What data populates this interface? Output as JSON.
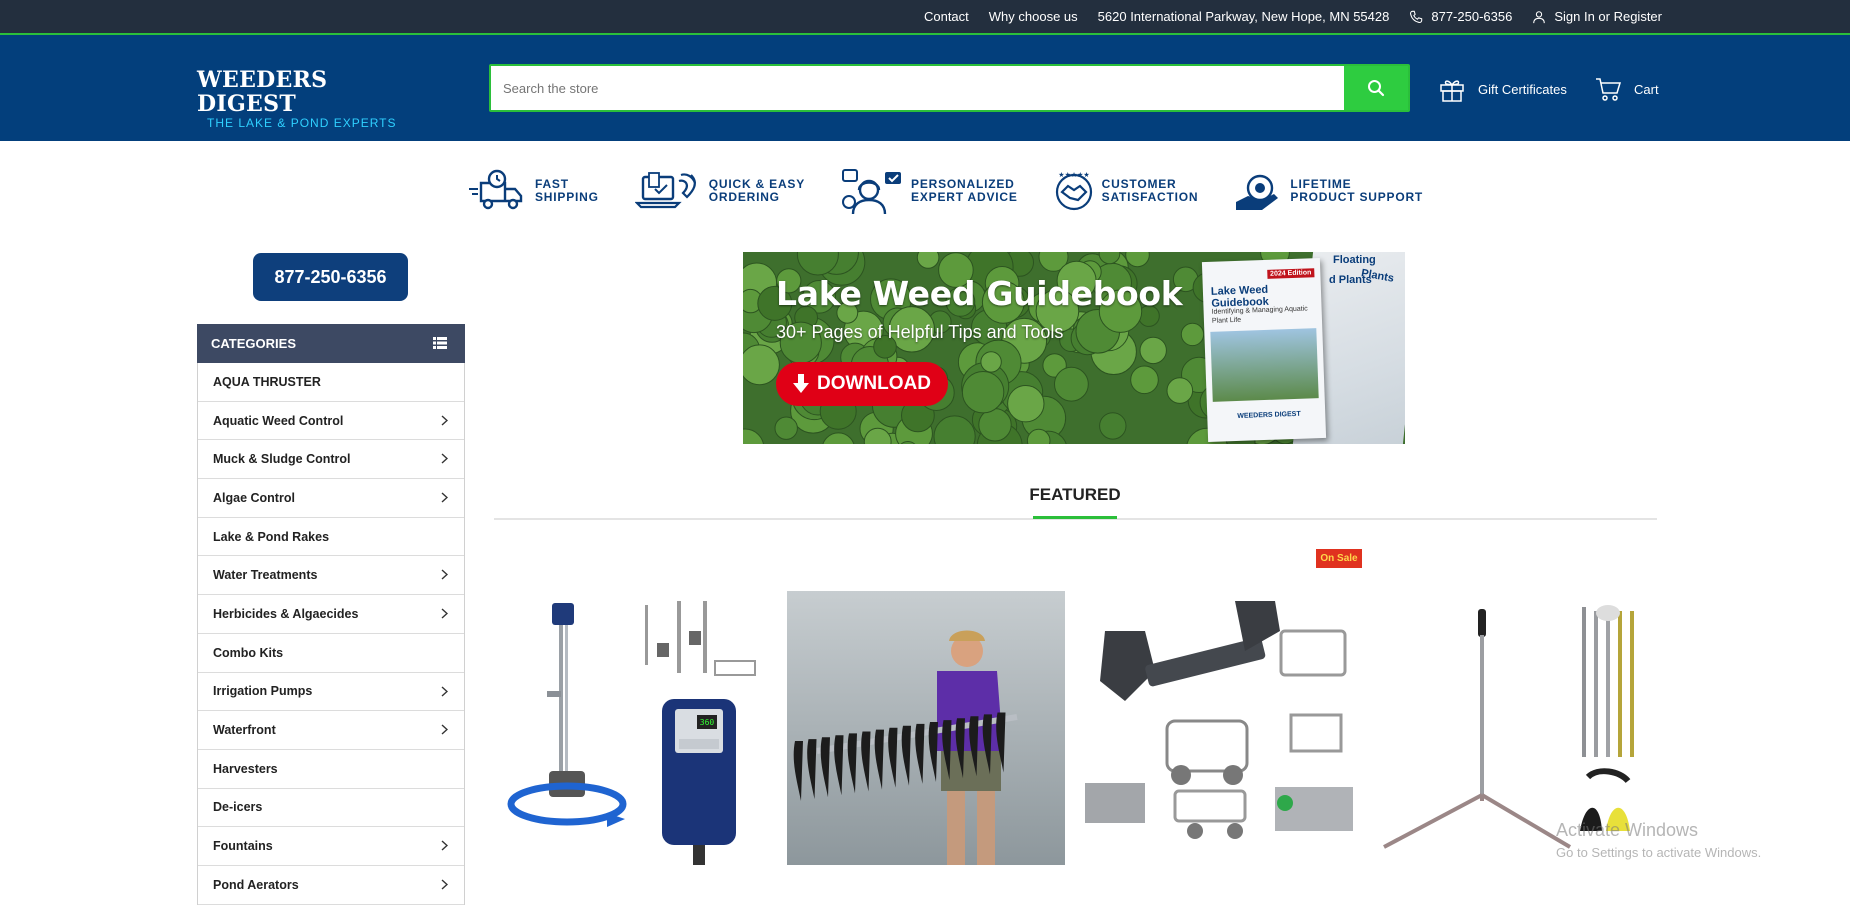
{
  "topbar": {
    "contact": "Contact",
    "why": "Why choose us",
    "address": "5620 International Parkway, New Hope, MN 55428",
    "phone": "877-250-6356",
    "signin": "Sign In or Register"
  },
  "header": {
    "logo_line1": "WEEDERS DIGEST",
    "logo_line2": "THE LAKE & POND EXPERTS",
    "search_placeholder": "Search the store",
    "gift": "Gift Certificates",
    "cart": "Cart"
  },
  "features": [
    {
      "line1": "FAST",
      "line2": "SHIPPING",
      "icon": "truck-icon"
    },
    {
      "line1": "QUICK & EASY",
      "line2": "ORDERING",
      "icon": "order-icon"
    },
    {
      "line1": "PERSONALIZED",
      "line2": "EXPERT ADVICE",
      "icon": "expert-icon"
    },
    {
      "line1": "CUSTOMER",
      "line2": "SATISFACTION",
      "icon": "handshake-icon"
    },
    {
      "line1": "LIFETIME",
      "line2": "PRODUCT SUPPORT",
      "icon": "support-icon"
    }
  ],
  "sidebar": {
    "phone": "877-250-6356",
    "categories_title": "CATEGORIES",
    "items": [
      {
        "label": "AQUA THRUSTER",
        "has_children": false
      },
      {
        "label": "Aquatic Weed Control",
        "has_children": true
      },
      {
        "label": "Muck & Sludge Control",
        "has_children": true
      },
      {
        "label": "Algae Control",
        "has_children": true
      },
      {
        "label": "Lake & Pond Rakes",
        "has_children": false
      },
      {
        "label": "Water Treatments",
        "has_children": true
      },
      {
        "label": "Herbicides & Algaecides",
        "has_children": true
      },
      {
        "label": "Combo Kits",
        "has_children": false
      },
      {
        "label": "Irrigation Pumps",
        "has_children": true
      },
      {
        "label": "Waterfront",
        "has_children": true
      },
      {
        "label": "Harvesters",
        "has_children": false
      },
      {
        "label": "De-icers",
        "has_children": false
      },
      {
        "label": "Fountains",
        "has_children": true
      },
      {
        "label": "Pond Aerators",
        "has_children": true
      }
    ]
  },
  "banner": {
    "title": "Lake Weed Guidebook",
    "subtitle": "30+ Pages of Helpful Tips and Tools",
    "button": "DOWNLOAD",
    "book_title": "Lake Weed Guidebook",
    "book_edition": "2024 Edition",
    "book_subtitle": "Identifying & Managing Aquatic Plant Life",
    "book_logo": "WEEDERS DIGEST",
    "page_label1": "Floating",
    "page_label2": "Plants",
    "page_label3": "d Plants"
  },
  "featured": {
    "title": "FEATURED",
    "sale_badge": "On Sale"
  },
  "watermark": {
    "line1": "Activate Windows",
    "line2": "Go to Settings to activate Windows."
  },
  "colors": {
    "topbar": "#232f3e",
    "header": "#033f7c",
    "accent_green": "#2ecc40",
    "category_head": "#3d4963",
    "sale": "#e0321f"
  }
}
